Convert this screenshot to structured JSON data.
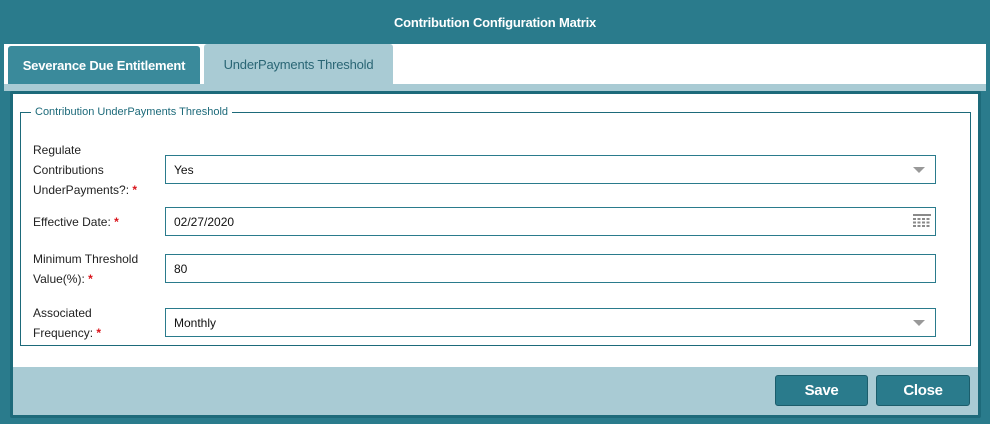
{
  "dialog": {
    "title": "Contribution Configuration Matrix"
  },
  "tabs": [
    {
      "label": "Severance Due Entitlement"
    },
    {
      "label": "UnderPayments Threshold"
    }
  ],
  "group": {
    "legend": "Contribution UnderPayments Threshold"
  },
  "fields": {
    "regulate": {
      "label": "Regulate Contributions UnderPayments?:",
      "required": "*",
      "value": "Yes"
    },
    "effective_date": {
      "label": "Effective Date:",
      "required": "*",
      "value": "02/27/2020"
    },
    "min_threshold": {
      "label": "Minimum Threshold Value(%):",
      "required": "*",
      "value": "80"
    },
    "frequency": {
      "label": "Associated Frequency:",
      "required": "*",
      "value": "Monthly"
    }
  },
  "buttons": {
    "save": "Save",
    "close": "Close"
  },
  "colors": {
    "primary": "#2a7b8c",
    "accent_light": "#a9cbd4",
    "required": "#d9141b"
  }
}
